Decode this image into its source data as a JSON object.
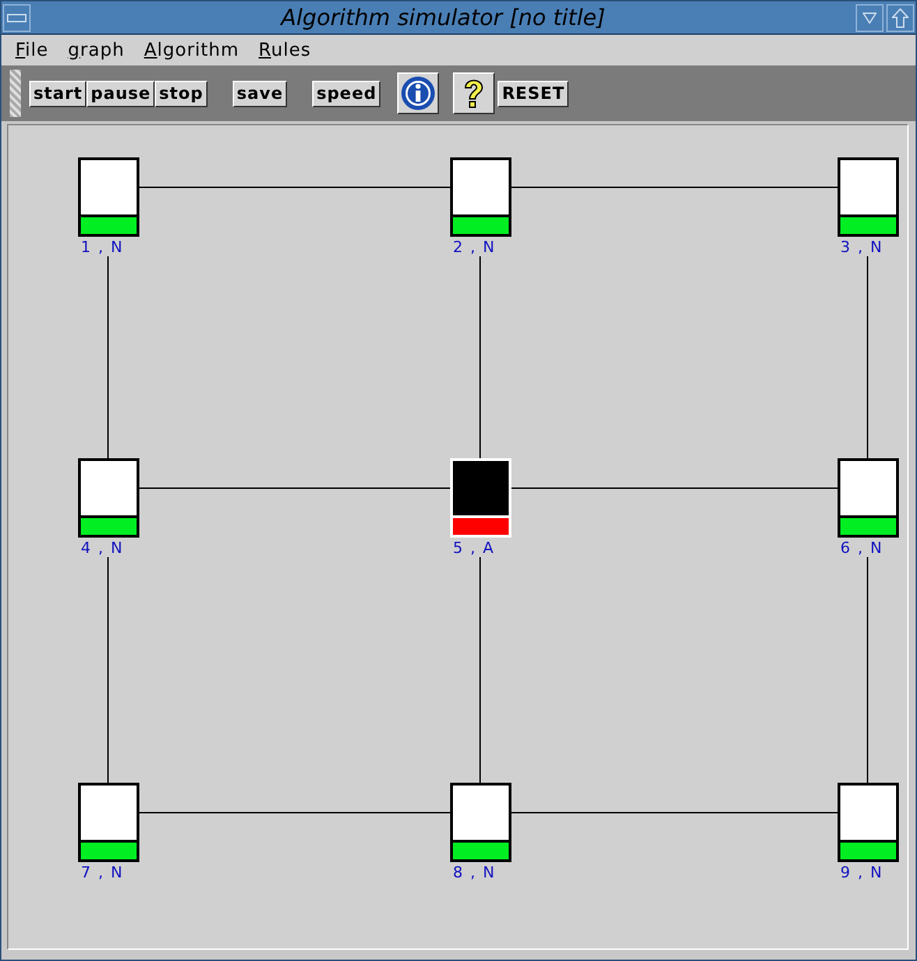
{
  "window": {
    "title": "Algorithm simulator [no title]"
  },
  "menu": [
    {
      "label": "File"
    },
    {
      "label": "graph"
    },
    {
      "label": "Algorithm"
    },
    {
      "label": "Rules"
    }
  ],
  "toolbar": [
    [
      {
        "kind": "button",
        "label": "start"
      },
      {
        "kind": "button",
        "label": "pause"
      },
      {
        "kind": "button",
        "label": "stop"
      }
    ],
    [
      {
        "kind": "button",
        "label": "save"
      }
    ],
    [
      {
        "kind": "button",
        "label": "speed"
      }
    ],
    [
      {
        "kind": "info"
      }
    ],
    [
      {
        "kind": "help"
      },
      {
        "kind": "button",
        "label": "RESET"
      }
    ]
  ],
  "graph": {
    "rows": [
      [
        {
          "label": "1 , N",
          "active": false,
          "right_edge": true,
          "down_edge": true
        },
        {
          "label": "2 , N",
          "active": false,
          "right_edge": true,
          "down_edge": true
        },
        {
          "label": "3 , N",
          "active": false,
          "down_edge": true
        }
      ],
      [
        {
          "label": "4 , N",
          "active": false,
          "right_edge": true,
          "down_edge": true
        },
        {
          "label": "5 , A",
          "active": true,
          "right_edge": true,
          "down_edge": true
        },
        {
          "label": "6 , N",
          "active": false,
          "down_edge": true
        }
      ],
      [
        {
          "label": "7 , N",
          "active": false,
          "right_edge": true
        },
        {
          "label": "8 , N",
          "active": false,
          "right_edge": true
        },
        {
          "label": "9 , N",
          "active": false
        }
      ]
    ]
  }
}
